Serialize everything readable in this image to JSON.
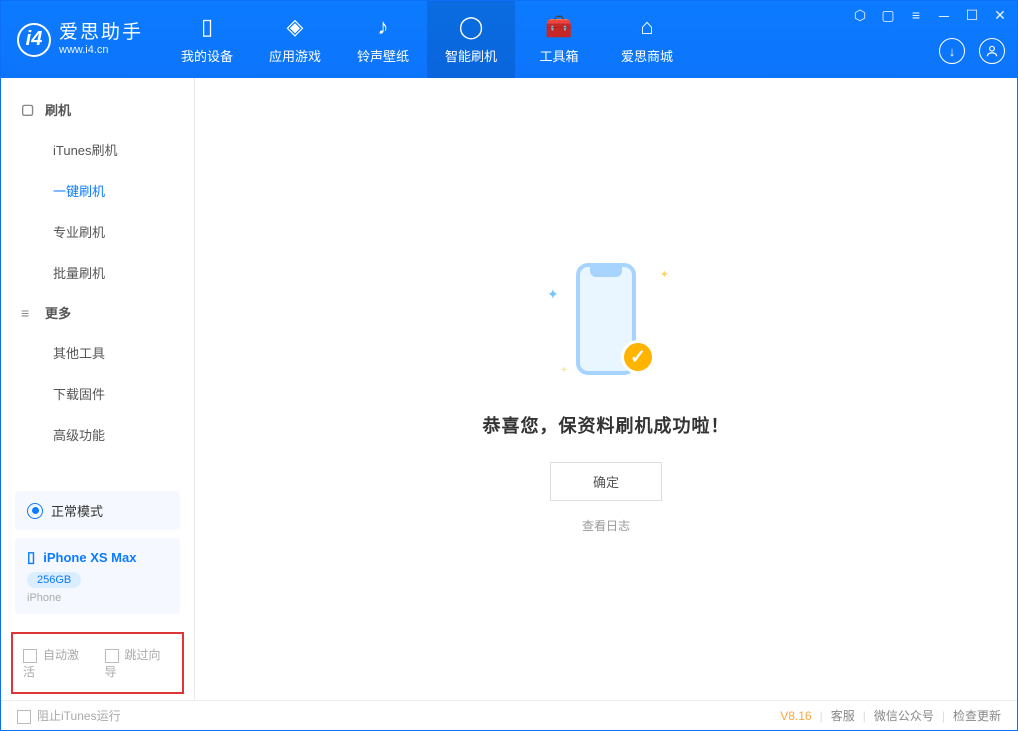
{
  "app": {
    "name_cn": "爱思助手",
    "name_en": "www.i4.cn",
    "version": "V8.16"
  },
  "nav": {
    "items": [
      {
        "label": "我的设备"
      },
      {
        "label": "应用游戏"
      },
      {
        "label": "铃声壁纸"
      },
      {
        "label": "智能刷机"
      },
      {
        "label": "工具箱"
      },
      {
        "label": "爱思商城"
      }
    ]
  },
  "sidebar": {
    "flash": {
      "title": "刷机",
      "items": [
        "iTunes刷机",
        "一键刷机",
        "专业刷机",
        "批量刷机"
      ]
    },
    "more": {
      "title": "更多",
      "items": [
        "其他工具",
        "下载固件",
        "高级功能"
      ]
    }
  },
  "device": {
    "mode": "正常模式",
    "name": "iPhone XS Max",
    "storage": "256GB",
    "type": "iPhone"
  },
  "checkboxes": {
    "auto_activate": "自动激活",
    "skip_guide": "跳过向导"
  },
  "main": {
    "success": "恭喜您，保资料刷机成功啦！",
    "ok": "确定",
    "view_log": "查看日志"
  },
  "footer": {
    "block_itunes": "阻止iTunes运行",
    "links": [
      "客服",
      "微信公众号",
      "检查更新"
    ]
  }
}
